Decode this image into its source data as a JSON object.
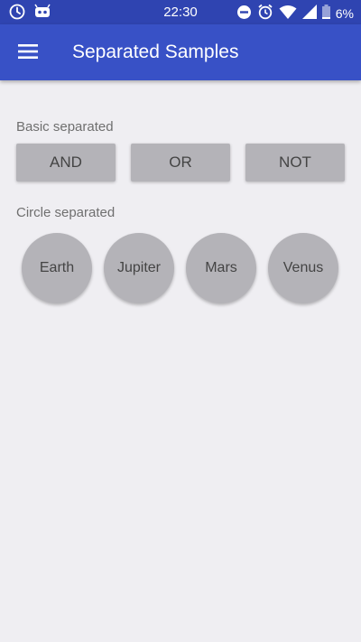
{
  "status_bar": {
    "time": "22:30",
    "battery_text": "6%",
    "icons_left": [
      "clock-icon",
      "android-icon"
    ],
    "icons_right": [
      "do-not-disturb-icon",
      "alarm-icon",
      "wifi-icon",
      "signal-icon"
    ]
  },
  "app_bar": {
    "title": "Separated Samples",
    "menu_icon": "hamburger-menu-icon"
  },
  "basic": {
    "label": "Basic separated",
    "buttons": [
      "AND",
      "OR",
      "NOT"
    ]
  },
  "circle": {
    "label": "Circle separated",
    "buttons": [
      "Earth",
      "Jupiter",
      "Mars",
      "Venus"
    ]
  },
  "colors": {
    "status_bar": "#2f44b1",
    "app_bar": "#3851c6",
    "background": "#efeef2",
    "button": "#b4b3b8"
  }
}
